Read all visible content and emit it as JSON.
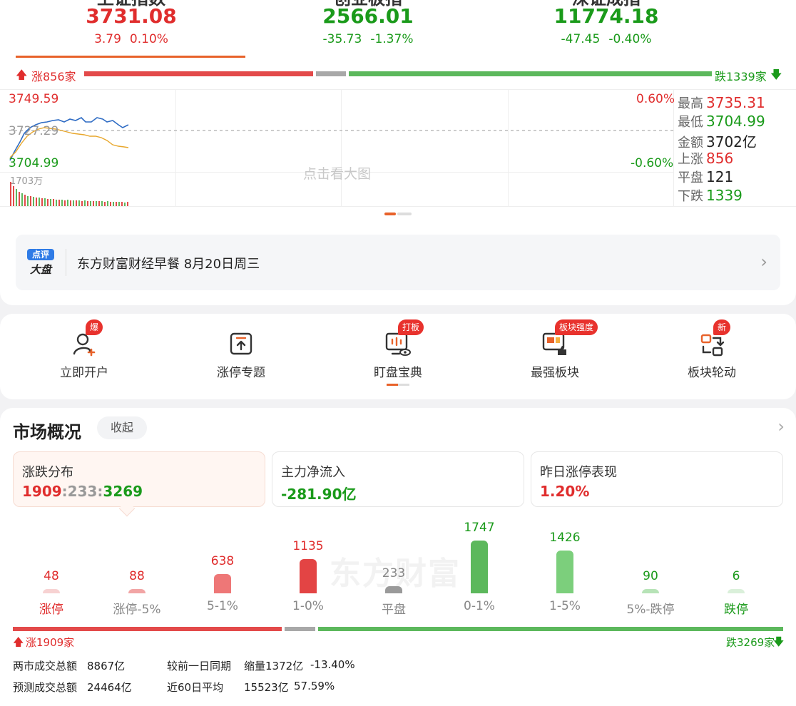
{
  "indices": [
    {
      "name": "上证指数",
      "value": "3731.08",
      "change": "3.79",
      "pct": "0.10%",
      "color": "#e02d2d"
    },
    {
      "name": "创业板指",
      "value": "2566.01",
      "change": "-35.73",
      "pct": "-1.37%",
      "color": "#1a9a1a"
    },
    {
      "name": "深证成指",
      "value": "11774.18",
      "change": "-47.45",
      "pct": "-0.40%",
      "color": "#1a9a1a"
    }
  ],
  "breadth": {
    "up_label": "涨856家",
    "down_label": "跌1339家",
    "up_count": 856,
    "flat_count": 121,
    "down_count": 1339
  },
  "chart": {
    "high": "3749.59",
    "mid": "3727.29",
    "low": "3704.99",
    "high_pct": "0.60%",
    "low_pct": "-0.60%",
    "vol_label": "1703万",
    "watermark": "点击看大图"
  },
  "stats": [
    {
      "label": "最高",
      "value": "3735.31",
      "color": "#e02d2d"
    },
    {
      "label": "最低",
      "value": "3704.99",
      "color": "#1a9a1a"
    },
    {
      "label": "金额",
      "value": "3702亿",
      "color": "#222"
    },
    {
      "label": "上涨",
      "value": "856",
      "color": "#e02d2d"
    },
    {
      "label": "平盘",
      "value": "121",
      "color": "#222"
    },
    {
      "label": "下跌",
      "value": "1339",
      "color": "#1a9a1a"
    }
  ],
  "news": {
    "logo_top": "点评",
    "logo_bottom": "大盘",
    "text": "东方财富财经早餐 8月20日周三"
  },
  "quick": [
    {
      "label": "立即开户",
      "badge": "爆",
      "icon": "user-plus-icon"
    },
    {
      "label": "涨停专题",
      "badge": "",
      "icon": "upload-box-icon"
    },
    {
      "label": "盯盘宝典",
      "badge": "打板",
      "icon": "monitor-eye-icon"
    },
    {
      "label": "最强板块",
      "badge": "板块强度",
      "icon": "board-thumb-icon"
    },
    {
      "label": "板块轮动",
      "badge": "新",
      "icon": "rotate-icon"
    }
  ],
  "market": {
    "title": "市场概况",
    "collapse": "收起",
    "cards": [
      {
        "title": "涨跌分布",
        "up": "1909",
        "flat": "233",
        "down": "3269"
      },
      {
        "title": "主力净流入",
        "value": "-281.90亿"
      },
      {
        "title": "昨日涨停表现",
        "value": "1.20%"
      }
    ],
    "watermark": "东方财富",
    "distribution": [
      {
        "label": "涨停",
        "count": 48,
        "color": "#f7d2d2",
        "label_color": "#e02d2d",
        "count_color": "#e02d2d"
      },
      {
        "label": "涨停-5%",
        "count": 88,
        "color": "#f2a5a5",
        "label_color": "#888",
        "count_color": "#e02d2d"
      },
      {
        "label": "5-1%",
        "count": 638,
        "color": "#ee7777",
        "label_color": "#888",
        "count_color": "#e02d2d"
      },
      {
        "label": "1-0%",
        "count": 1135,
        "color": "#e34444",
        "label_color": "#888",
        "count_color": "#e02d2d"
      },
      {
        "label": "平盘",
        "count": 233,
        "color": "#9a9a9a",
        "label_color": "#888",
        "count_color": "#888"
      },
      {
        "label": "0-1%",
        "count": 1747,
        "color": "#5cb85c",
        "label_color": "#888",
        "count_color": "#1a9a1a"
      },
      {
        "label": "1-5%",
        "count": 1426,
        "color": "#7ccf7c",
        "label_color": "#888",
        "count_color": "#1a9a1a"
      },
      {
        "label": "5%-跌停",
        "count": 90,
        "color": "#b7e3b7",
        "label_color": "#888",
        "count_color": "#1a9a1a"
      },
      {
        "label": "跌停",
        "count": 6,
        "color": "#daf0da",
        "label_color": "#1a9a1a",
        "count_color": "#1a9a1a"
      }
    ],
    "sum_up": "涨1909家",
    "sum_down": "跌3269家",
    "footer": {
      "total_label": "两市成交总额",
      "total_value": "8867亿",
      "compare_label": "较前一日同期",
      "compare_value": "缩量1372亿",
      "compare_pct": "-13.40%",
      "forecast_label": "预测成交总额",
      "forecast_value": "24464亿",
      "avg_label": "近60日平均",
      "avg_value": "15523亿",
      "avg_pct": "57.59%"
    }
  }
}
